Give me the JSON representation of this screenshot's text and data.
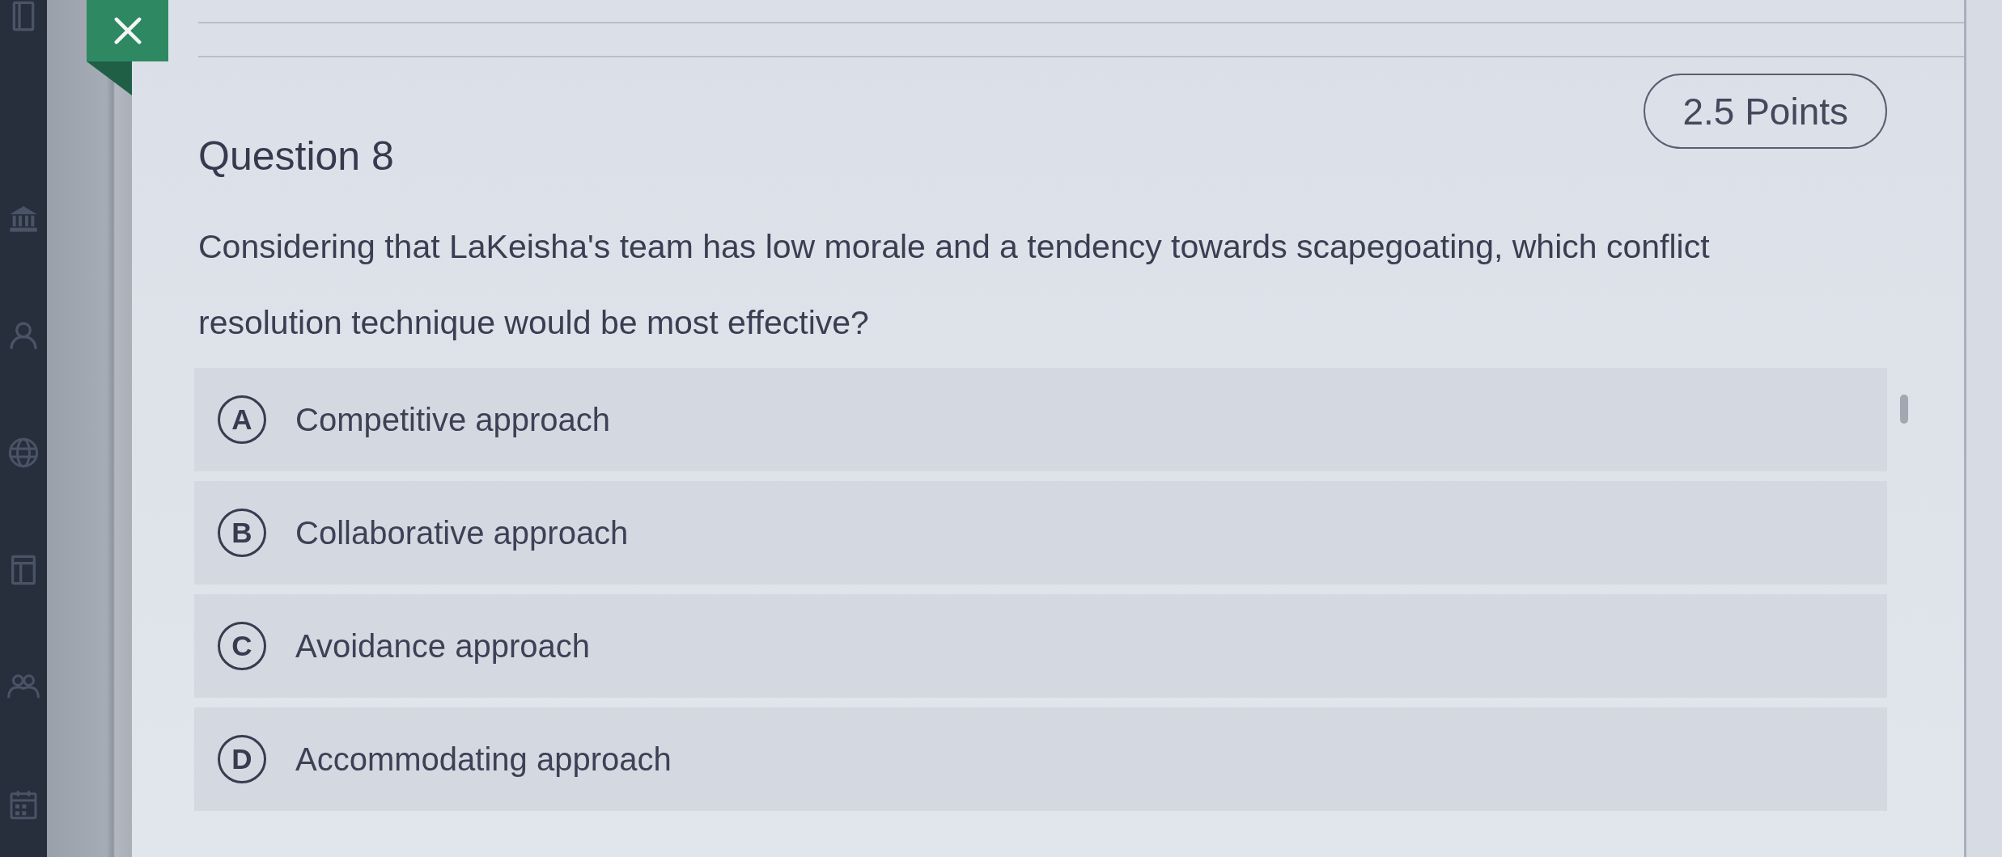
{
  "question": {
    "title": "Question 8",
    "points": "2.5 Points",
    "text": "Considering that LaKeisha's team has low morale and a tendency towards scapegoating, which conflict resolution technique would be most effective?"
  },
  "options": [
    {
      "letter": "A",
      "label": "Competitive approach",
      "selected": false
    },
    {
      "letter": "B",
      "label": "Collaborative approach",
      "selected": false
    },
    {
      "letter": "C",
      "label": "Avoidance approach",
      "selected": false
    },
    {
      "letter": "D",
      "label": "Accommodating approach",
      "selected": false
    }
  ]
}
